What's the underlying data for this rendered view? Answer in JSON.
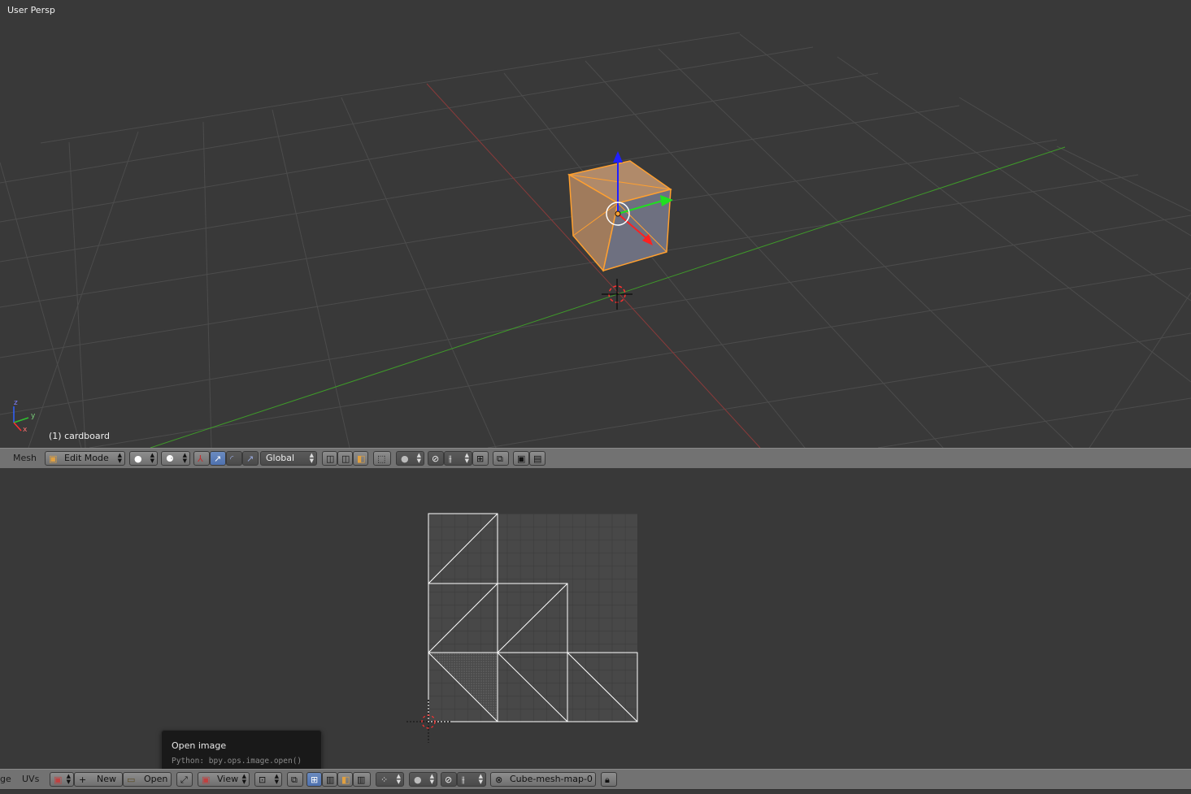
{
  "viewport3d": {
    "view_label": "User Persp",
    "object_label": "(1) cardboard",
    "axis_labels": {
      "z": "z",
      "y": "y",
      "x": "x"
    }
  },
  "header3d": {
    "menu_label": "Mesh",
    "mode": "Edit Mode",
    "transform_orientation": "Global",
    "icons": [
      "mode-icon",
      "viewport-shading-icon",
      "pivot-point-icon",
      "manipulator-toggle-icon",
      "translate-icon",
      "rotate-icon",
      "scale-icon",
      "vertex-select-icon",
      "edge-select-icon",
      "face-select-icon",
      "occlude-geometry-icon",
      "proportional-edit-icon",
      "snap-icon",
      "snap-target-icon",
      "snap-element-icon",
      "opengl-render-icon",
      "render-animation-icon"
    ]
  },
  "headerUV": {
    "editor_label_partial": "ge",
    "uvs_menu": "UVs",
    "new_label": "New",
    "open_label": "Open",
    "view_label": "View",
    "uv_map_name": "Cube-mesh-map-0"
  },
  "tooltip": {
    "title": "Open image",
    "python": "Python: bpy.ops.image.open()"
  },
  "colors": {
    "background": "#393939",
    "grid_line": "#4a4a4a",
    "x_axis": "#8a3a3a",
    "y_axis": "#3f9a2a",
    "selection": "#ffa030",
    "header": "#727272"
  }
}
